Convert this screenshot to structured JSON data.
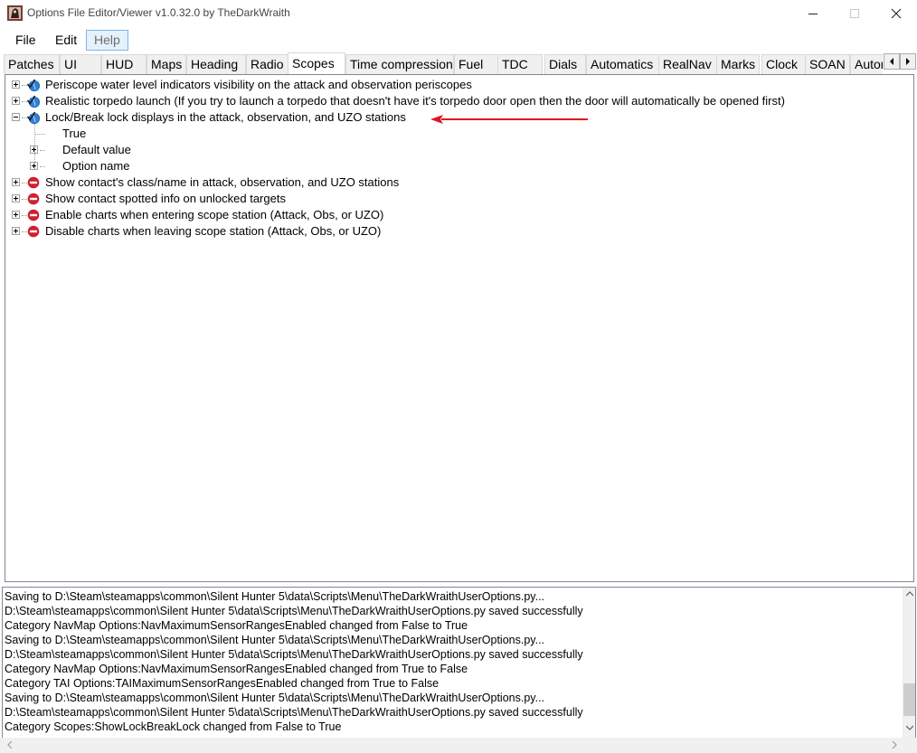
{
  "window": {
    "title": "Options File Editor/Viewer v1.0.32.0 by TheDarkWraith"
  },
  "menu": {
    "file": "File",
    "edit": "Edit",
    "help": "Help"
  },
  "tabs": [
    {
      "label": "Patches"
    },
    {
      "label": "UI"
    },
    {
      "label": "HUD"
    },
    {
      "label": "Maps"
    },
    {
      "label": "Heading"
    },
    {
      "label": "Radio"
    },
    {
      "label": "Scopes",
      "active": true
    },
    {
      "label": "Time compression"
    },
    {
      "label": "Fuel"
    },
    {
      "label": "TDC"
    },
    {
      "label": "Dials"
    },
    {
      "label": "Automatics"
    },
    {
      "label": "RealNav"
    },
    {
      "label": "Marks"
    },
    {
      "label": "Clock"
    },
    {
      "label": "SOAN"
    },
    {
      "label": "Autor"
    }
  ],
  "tree": {
    "items": [
      {
        "label": "Periscope water level indicators visibility on the attack and observation periscopes",
        "state": "enabled"
      },
      {
        "label": "Realistic torpedo launch (If you try to launch a torpedo that doesn't have it's torpedo door open then the door will automatically be opened first)",
        "state": "enabled"
      },
      {
        "label": "Lock/Break lock displays in the attack, observation, and UZO stations",
        "state": "enabled",
        "expanded": true,
        "children": [
          {
            "label": "True"
          },
          {
            "label": "Default value"
          },
          {
            "label": "Option name"
          }
        ]
      },
      {
        "label": "Show contact's class/name in attack, observation, and UZO stations",
        "state": "disabled"
      },
      {
        "label": "Show contact spotted info on unlocked targets",
        "state": "disabled"
      },
      {
        "label": "Enable charts when entering scope station (Attack, Obs, or UZO)",
        "state": "disabled"
      },
      {
        "label": "Disable charts when leaving scope station (Attack, Obs, or UZO)",
        "state": "disabled"
      }
    ]
  },
  "log": [
    "Saving to D:\\Steam\\steamapps\\common\\Silent Hunter 5\\data\\Scripts\\Menu\\TheDarkWraithUserOptions.py...",
    "D:\\Steam\\steamapps\\common\\Silent Hunter 5\\data\\Scripts\\Menu\\TheDarkWraithUserOptions.py saved successfully",
    "Category NavMap Options:NavMaximumSensorRangesEnabled changed from False to True",
    "Saving to D:\\Steam\\steamapps\\common\\Silent Hunter 5\\data\\Scripts\\Menu\\TheDarkWraithUserOptions.py...",
    "D:\\Steam\\steamapps\\common\\Silent Hunter 5\\data\\Scripts\\Menu\\TheDarkWraithUserOptions.py saved successfully",
    "Category NavMap Options:NavMaximumSensorRangesEnabled changed from True to False",
    "Category TAI Options:TAIMaximumSensorRangesEnabled changed from True to False",
    "Saving to D:\\Steam\\steamapps\\common\\Silent Hunter 5\\data\\Scripts\\Menu\\TheDarkWraithUserOptions.py...",
    "D:\\Steam\\steamapps\\common\\Silent Hunter 5\\data\\Scripts\\Menu\\TheDarkWraithUserOptions.py saved successfully",
    "Category Scopes:ShowLockBreakLock changed from False to True"
  ],
  "colors": {
    "annotation_arrow": "#e0141e",
    "enabled_icon": "#2f7fd6",
    "disabled_icon": "#d02030"
  },
  "icons": {
    "enabled": "check-globe-icon",
    "disabled": "no-entry-icon"
  }
}
